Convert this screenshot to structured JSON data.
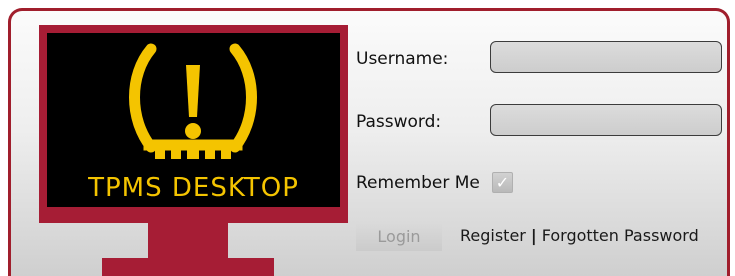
{
  "logo": {
    "text": "TPMS DESKTOP",
    "icon": "tire-pressure-warning-icon",
    "colors": {
      "frame": "#a61d35",
      "screen": "#000000",
      "accent": "#f4c400"
    }
  },
  "form": {
    "username_label": "Username:",
    "username_value": "",
    "password_label": "Password:",
    "password_value": "",
    "remember_label": "Remember Me",
    "remember_checked": true,
    "checkmark": "✓"
  },
  "actions": {
    "login_label": "Login",
    "register_label": "Register",
    "separator": "|",
    "forgotten_label": "Forgotten Password"
  },
  "theme": {
    "border": "#a01e2c"
  }
}
